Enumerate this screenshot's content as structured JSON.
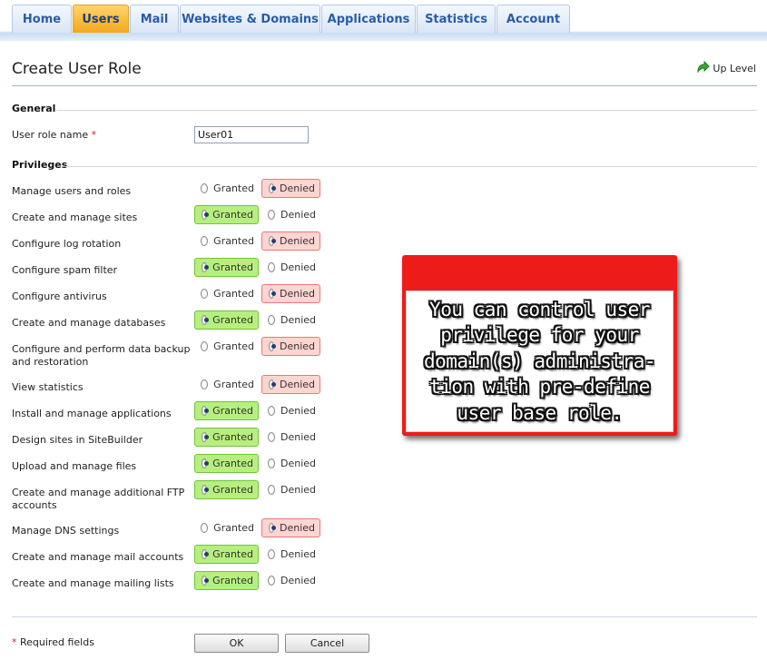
{
  "tabs": [
    "Home",
    "Users",
    "Mail",
    "Websites & Domains",
    "Applications",
    "Statistics",
    "Account"
  ],
  "active_tab": "Users",
  "header": {
    "title": "Create User Role",
    "up_level": "Up Level"
  },
  "general": {
    "section_title": "General",
    "role_name_label": "User role name",
    "required_mark": "*",
    "role_name_value": "User01"
  },
  "privileges": {
    "section_title": "Privileges",
    "granted_label": "Granted",
    "denied_label": "Denied",
    "items": [
      {
        "label": "Manage users and roles",
        "state": "denied"
      },
      {
        "label": "Create and manage sites",
        "state": "granted"
      },
      {
        "label": "Configure log rotation",
        "state": "denied"
      },
      {
        "label": "Configure spam filter",
        "state": "granted"
      },
      {
        "label": "Configure antivirus",
        "state": "denied"
      },
      {
        "label": "Create and manage databases",
        "state": "granted"
      },
      {
        "label": "Configure and perform data backup and restoration",
        "state": "denied"
      },
      {
        "label": "View statistics",
        "state": "denied"
      },
      {
        "label": "Install and manage applications",
        "state": "granted"
      },
      {
        "label": "Design sites in SiteBuilder",
        "state": "granted"
      },
      {
        "label": "Upload and manage files",
        "state": "granted"
      },
      {
        "label": "Create and manage additional FTP accounts",
        "state": "granted"
      },
      {
        "label": "Manage DNS settings",
        "state": "denied"
      },
      {
        "label": "Create and manage mail accounts",
        "state": "granted"
      },
      {
        "label": "Create and manage mailing lists",
        "state": "granted"
      }
    ]
  },
  "footer": {
    "required_note": "Required fields",
    "ok_label": "OK",
    "cancel_label": "Cancel"
  },
  "callout": {
    "text": "You can control user\nprivilege for your\ndomain(s) administra-\ntion with pre-define\nuser base role."
  },
  "colors": {
    "tab_active": "#f3a81c",
    "granted_bg": "#b7ef7e",
    "denied_bg": "#ffd5d2",
    "callout_red": "#ee1b1b"
  }
}
